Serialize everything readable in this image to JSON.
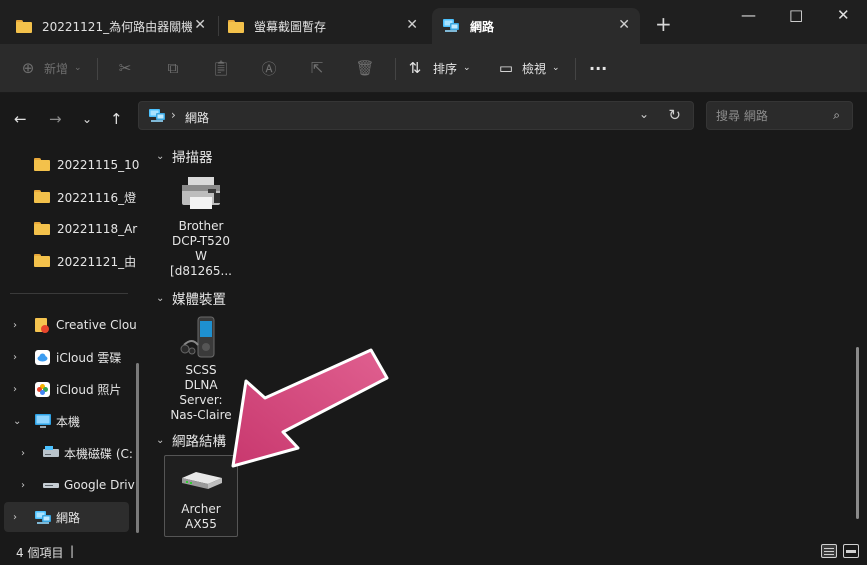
{
  "tabs": [
    {
      "label": "20221121_為何路由器關機",
      "icon": "folder-icon",
      "active": false
    },
    {
      "label": "螢幕截圖暫存",
      "icon": "folder-icon",
      "active": false
    },
    {
      "label": "網路",
      "icon": "network-icon",
      "active": true
    }
  ],
  "window_controls": {
    "new_tab": "+",
    "minimize": "—",
    "maximize": "□",
    "close": "✕"
  },
  "toolbar": {
    "new_label": "新增",
    "sort_label": "排序",
    "view_label": "檢視",
    "more_label": "···"
  },
  "address": {
    "crumb": "網路",
    "search_placeholder": "搜尋 網路"
  },
  "sidebar": {
    "items": [
      {
        "label": "20221115_10",
        "icon": "folder-icon"
      },
      {
        "label": "20221116_燈",
        "icon": "folder-icon"
      },
      {
        "label": "20221118_Ar",
        "icon": "folder-icon"
      },
      {
        "label": "20221121_由",
        "icon": "folder-icon"
      },
      {
        "label": "Creative Clou",
        "icon": "creative-cloud-icon"
      },
      {
        "label": "iCloud 雲碟",
        "icon": "icloud-drive-icon"
      },
      {
        "label": "iCloud 照片",
        "icon": "icloud-photos-icon"
      },
      {
        "label": "本機",
        "icon": "computer-icon"
      },
      {
        "label": "本機磁碟 (C:",
        "icon": "local-disk-icon"
      },
      {
        "label": "Google Driv",
        "icon": "drive-icon"
      },
      {
        "label": "網路",
        "icon": "network-icon"
      }
    ]
  },
  "groups": [
    {
      "label": "掃描器",
      "items": [
        {
          "name": "Brother\nDCP-T520\nW\n[d81265...",
          "icon": "printer-icon"
        }
      ]
    },
    {
      "label": "媒體裝置",
      "items": [
        {
          "name": "SCSS\nDLNA\nServer:\nNas-Claire",
          "icon": "media-player-icon"
        }
      ]
    },
    {
      "label": "網路結構",
      "items": [
        {
          "name": "Archer\nAX55",
          "icon": "router-icon"
        }
      ]
    }
  ],
  "status": {
    "item_count": "4 個項目",
    "separator": "|"
  },
  "colors": {
    "accent": "#4cc2ff",
    "arrow": "#c8386e",
    "background": "#191919",
    "toolbar": "#2b2b2b"
  }
}
